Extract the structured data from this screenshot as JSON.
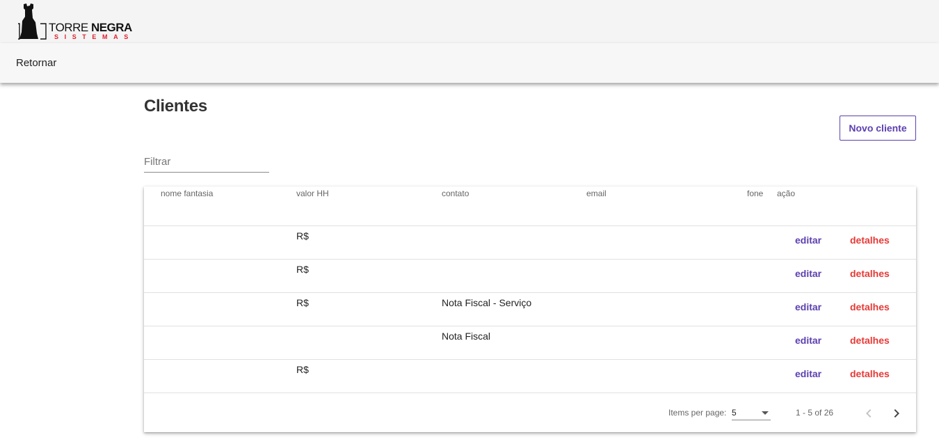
{
  "brand": {
    "line1_regular": "TORRE",
    "line1_bold": "NEGRA",
    "line2": "SISTEMAS",
    "accent_color": "#e0202e"
  },
  "nav": {
    "back_label": "Retornar"
  },
  "page": {
    "title": "Clientes",
    "new_button_label": "Novo cliente"
  },
  "filter": {
    "placeholder": "Filtrar",
    "value": ""
  },
  "table": {
    "headers": {
      "nome_fantasia": "nome fantasia",
      "valor_hh": "valor HH",
      "contato": "contato",
      "email": "email",
      "fone": "fone",
      "acao": "ação"
    },
    "rows": [
      {
        "nome_fantasia": "",
        "valor_hh": "R$",
        "contato": "",
        "email": "",
        "fone": "",
        "edit_label": "editar",
        "details_label": "detalhes"
      },
      {
        "nome_fantasia": "",
        "valor_hh": "R$",
        "contato": "",
        "email": "",
        "fone": "",
        "edit_label": "editar",
        "details_label": "detalhes"
      },
      {
        "nome_fantasia": "",
        "valor_hh": "R$",
        "contato": "Nota Fiscal - Serviço",
        "email": "",
        "fone": "",
        "edit_label": "editar",
        "details_label": "detalhes"
      },
      {
        "nome_fantasia": "",
        "valor_hh": "",
        "contato": "Nota Fiscal",
        "email": "",
        "fone": "",
        "edit_label": "editar",
        "details_label": "detalhes"
      },
      {
        "nome_fantasia": "",
        "valor_hh": "R$",
        "contato": "",
        "email": "",
        "fone": "",
        "edit_label": "editar",
        "details_label": "detalhes"
      }
    ]
  },
  "paginator": {
    "items_per_page_label": "Items per page:",
    "items_per_page_value": "5",
    "range_label": "1 - 5 of 26",
    "prev_icon": "chevron-left-icon",
    "next_icon": "chevron-right-icon"
  },
  "colors": {
    "primary": "#5c3fb0",
    "warn": "#e53935"
  }
}
